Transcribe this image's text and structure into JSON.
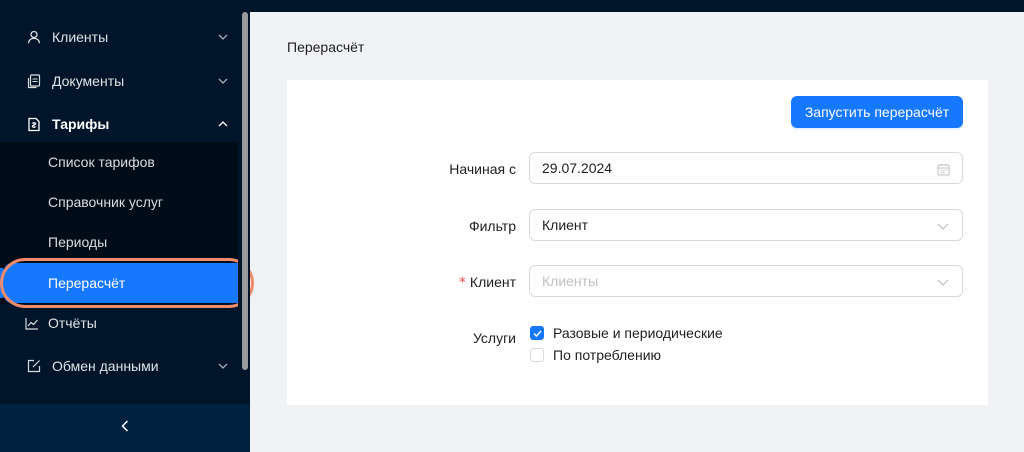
{
  "sidebar": {
    "items": [
      {
        "label": "Клиенты",
        "icon": "user-icon"
      },
      {
        "label": "Документы",
        "icon": "documents-icon"
      },
      {
        "label": "Тарифы",
        "icon": "tariff-icon"
      },
      {
        "label": "Отчёты",
        "icon": "chart-icon"
      },
      {
        "label": "Обмен данными",
        "icon": "edit-square-icon"
      }
    ],
    "submenu": [
      {
        "label": "Список тарифов"
      },
      {
        "label": "Справочник услуг"
      },
      {
        "label": "Периоды"
      },
      {
        "label": "Перерасчёт",
        "selected": true
      }
    ]
  },
  "page": {
    "title": "Перерасчёт",
    "run_button": "Запустить перерасчёт"
  },
  "form": {
    "start_label": "Начиная с",
    "start_value": "29.07.2024",
    "filter_label": "Фильтр",
    "filter_value": "Клиент",
    "client_required_mark": "*",
    "client_label": "Клиент",
    "client_placeholder": "Клиенты",
    "services_label": "Услуги",
    "services": [
      {
        "label": "Разовые и периодические",
        "checked": true
      },
      {
        "label": "По потреблению",
        "checked": false
      }
    ]
  },
  "colors": {
    "sidebar_bg": "#001529",
    "primary": "#1677ff",
    "highlight_ring": "#f08a6c",
    "required": "#ff4d4f"
  }
}
